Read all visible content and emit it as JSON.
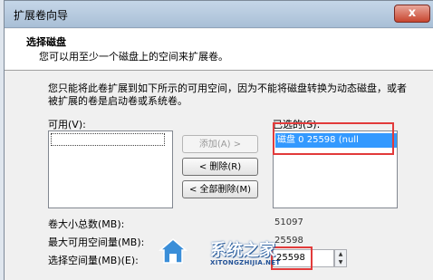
{
  "window": {
    "title": "扩展卷向导",
    "close_label": "x"
  },
  "header": {
    "title": "选择磁盘",
    "description": "您可以用至少一个磁盘上的空间来扩展卷。"
  },
  "description": "您只能将此卷扩展到如下所示的可用空间，因为不能将磁盘转换为动态磁盘，或者被扩展的卷是启动卷或系统卷。",
  "available": {
    "label": "可用(V):"
  },
  "selected": {
    "label": "已选的(S):",
    "items": [
      "磁盘 0      25598 (null"
    ]
  },
  "buttons": {
    "add": "添加(A) >",
    "remove": "< 删除(R)",
    "remove_all": "< 全部删除(M)"
  },
  "sizes": {
    "total_label": "卷大小总数(MB):",
    "total_value": "51097",
    "max_label": "最大可用空间量(MB):",
    "max_value": "25598",
    "select_label": "选择空间量(MB)(E):",
    "select_value": "25598"
  },
  "watermark": {
    "title": "系统之家",
    "url": "XITONGZHIJIA.NET"
  }
}
